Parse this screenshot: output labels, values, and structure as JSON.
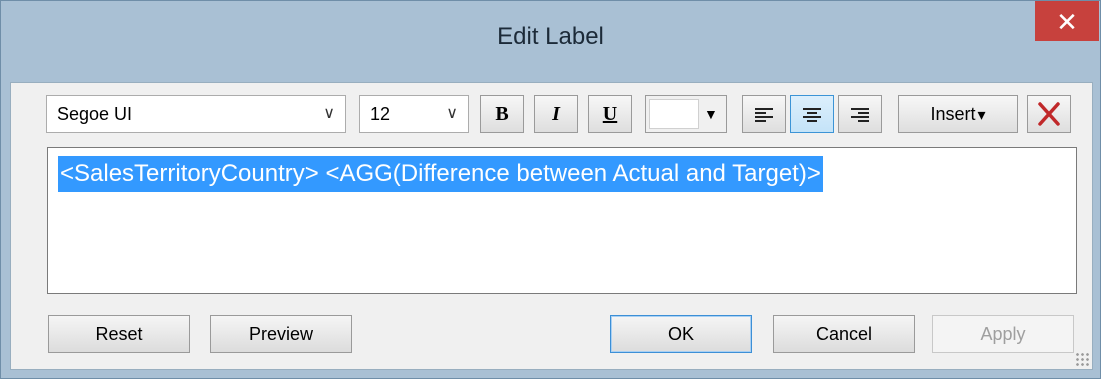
{
  "window": {
    "title": "Edit Label",
    "close_glyph": "✕"
  },
  "toolbar": {
    "font_name": "Segoe UI",
    "font_size": "12",
    "dropdown_glyph": "∨",
    "bold_label": "B",
    "italic_label": "I",
    "underline_label": "U",
    "color_value": "#ffffff",
    "color_arrow": "▼",
    "align_selected": "center",
    "insert_label": "Insert",
    "insert_arrow": "▾",
    "clear_icon": "red-x-icon"
  },
  "editor": {
    "text": "<SalesTerritoryCountry>  <AGG(Difference between Actual and Target)>"
  },
  "buttons": {
    "reset": "Reset",
    "preview": "Preview",
    "ok": "OK",
    "cancel": "Cancel",
    "apply": "Apply"
  },
  "colors": {
    "selection": "#3399ff",
    "close": "#c7413d",
    "frame": "#a9c0d4"
  }
}
